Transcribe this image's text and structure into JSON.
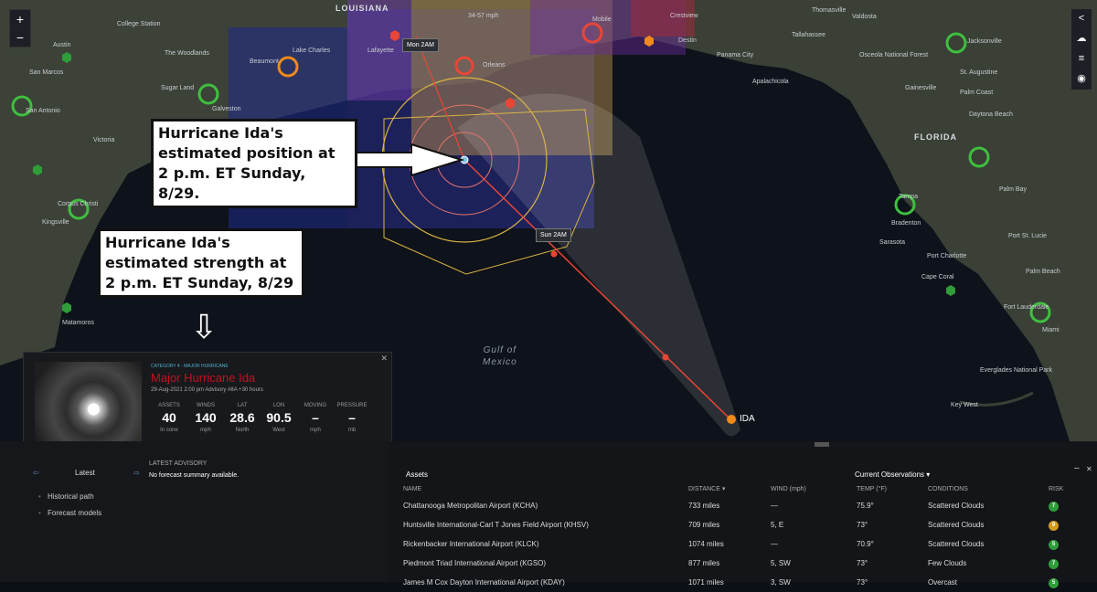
{
  "map": {
    "controls": {
      "zoom_in": "+",
      "zoom_out": "−",
      "collapse": "<"
    },
    "states": [
      "LOUISIANA",
      "FLORIDA"
    ],
    "water": [
      "Gulf of",
      "Mexico"
    ],
    "places": [
      "College Station",
      "Austin",
      "San Marcos",
      "San Antonio",
      "Victoria",
      "Corpus Christi",
      "Kingsville",
      "Matamoros",
      "The Woodlands",
      "Sugar Land",
      "Galveston",
      "Beaumont",
      "Lake Charles",
      "Lafayette",
      "Mobile",
      "Crestview",
      "Destin",
      "Panama City",
      "Tallahassee",
      "Apalachicola",
      "Thomasville",
      "Valdosta",
      "Osceola National Forest",
      "St. Augustine",
      "Palm Coast",
      "Gainesville",
      "Daytona Beach",
      "Palm Bay",
      "Port St. Lucie",
      "Tampa",
      "Bradenton",
      "Sarasota",
      "Port Charlotte",
      "Cape Coral",
      "Palm Beach",
      "Fort Lauderdale",
      "Miami",
      "Everglades National Park",
      "Key West",
      "Orleans",
      "Jacksonville"
    ],
    "storm_marker": "IDA",
    "time_tags": [
      "Mon 2AM",
      "Sun 2AM"
    ],
    "wind_label": "34-57 mph",
    "annotations": {
      "position": "Hurricane Ida's estimated position at 2 p.m. ET Sunday, 8/29.",
      "strength": "Hurricane Ida's estimated strength at 2 p.m. ET Sunday, 8/29"
    },
    "arrow_down": "⇩"
  },
  "storm": {
    "category": "CATEGORY 4 - MAJOR HURRICANE",
    "name": "Major Hurricane Ida",
    "advisory": "29-Aug-2021 2:00 pm Advisory #8A +30 hours",
    "close": "✕",
    "stats": [
      {
        "h": "ASSETS",
        "v": "40",
        "u": "In cone"
      },
      {
        "h": "WINDS",
        "v": "140",
        "u": "mph"
      },
      {
        "h": "LAT",
        "v": "28.6",
        "u": "North"
      },
      {
        "h": "LON",
        "v": "90.5",
        "u": "West"
      },
      {
        "h": "MOVING",
        "v": "–",
        "u": "mph"
      },
      {
        "h": "PRESSURE",
        "v": "–",
        "u": "mb"
      }
    ]
  },
  "sidebar": {
    "nav": {
      "prev": "⇦",
      "label": "Latest",
      "next": "⇨"
    },
    "items": [
      "Historical path",
      "Forecast models"
    ],
    "latest_advisory": "LATEST ADVISORY",
    "summary": "No forecast summary available."
  },
  "assets": {
    "title": "Assets",
    "observations": "Current Observations ▾",
    "minimize": "–",
    "close": "✕",
    "columns": [
      "NAME",
      "DISTANCE ▾",
      "WIND (mph)",
      "TEMP (°F)",
      "CONDITIONS",
      "RISK"
    ],
    "rows": [
      {
        "name": "Chattanooga Metropolitan Airport (KCHA)",
        "distance": "733 miles",
        "wind": "—",
        "temp": "75.9°",
        "conditions": "Scattered Clouds",
        "risk": "7",
        "risk_color": "#2e9d3a"
      },
      {
        "name": "Huntsville International-Carl T Jones Field Airport (KHSV)",
        "distance": "709 miles",
        "wind": "5, E",
        "temp": "73°",
        "conditions": "Scattered Clouds",
        "risk": "9",
        "risk_color": "#d49a1d"
      },
      {
        "name": "Rickenbacker International Airport (KLCK)",
        "distance": "1074 miles",
        "wind": "—",
        "temp": "70.9°",
        "conditions": "Scattered Clouds",
        "risk": "5",
        "risk_color": "#2e9d3a"
      },
      {
        "name": "Piedmont Triad International Airport (KGSO)",
        "distance": "877 miles",
        "wind": "5, SW",
        "temp": "73°",
        "conditions": "Few Clouds",
        "risk": "7",
        "risk_color": "#2e9d3a"
      },
      {
        "name": "James M Cox Dayton International Airport (KDAY)",
        "distance": "1071 miles",
        "wind": "3, SW",
        "temp": "73°",
        "conditions": "Overcast",
        "risk": "5",
        "risk_color": "#2e9d3a"
      }
    ]
  }
}
